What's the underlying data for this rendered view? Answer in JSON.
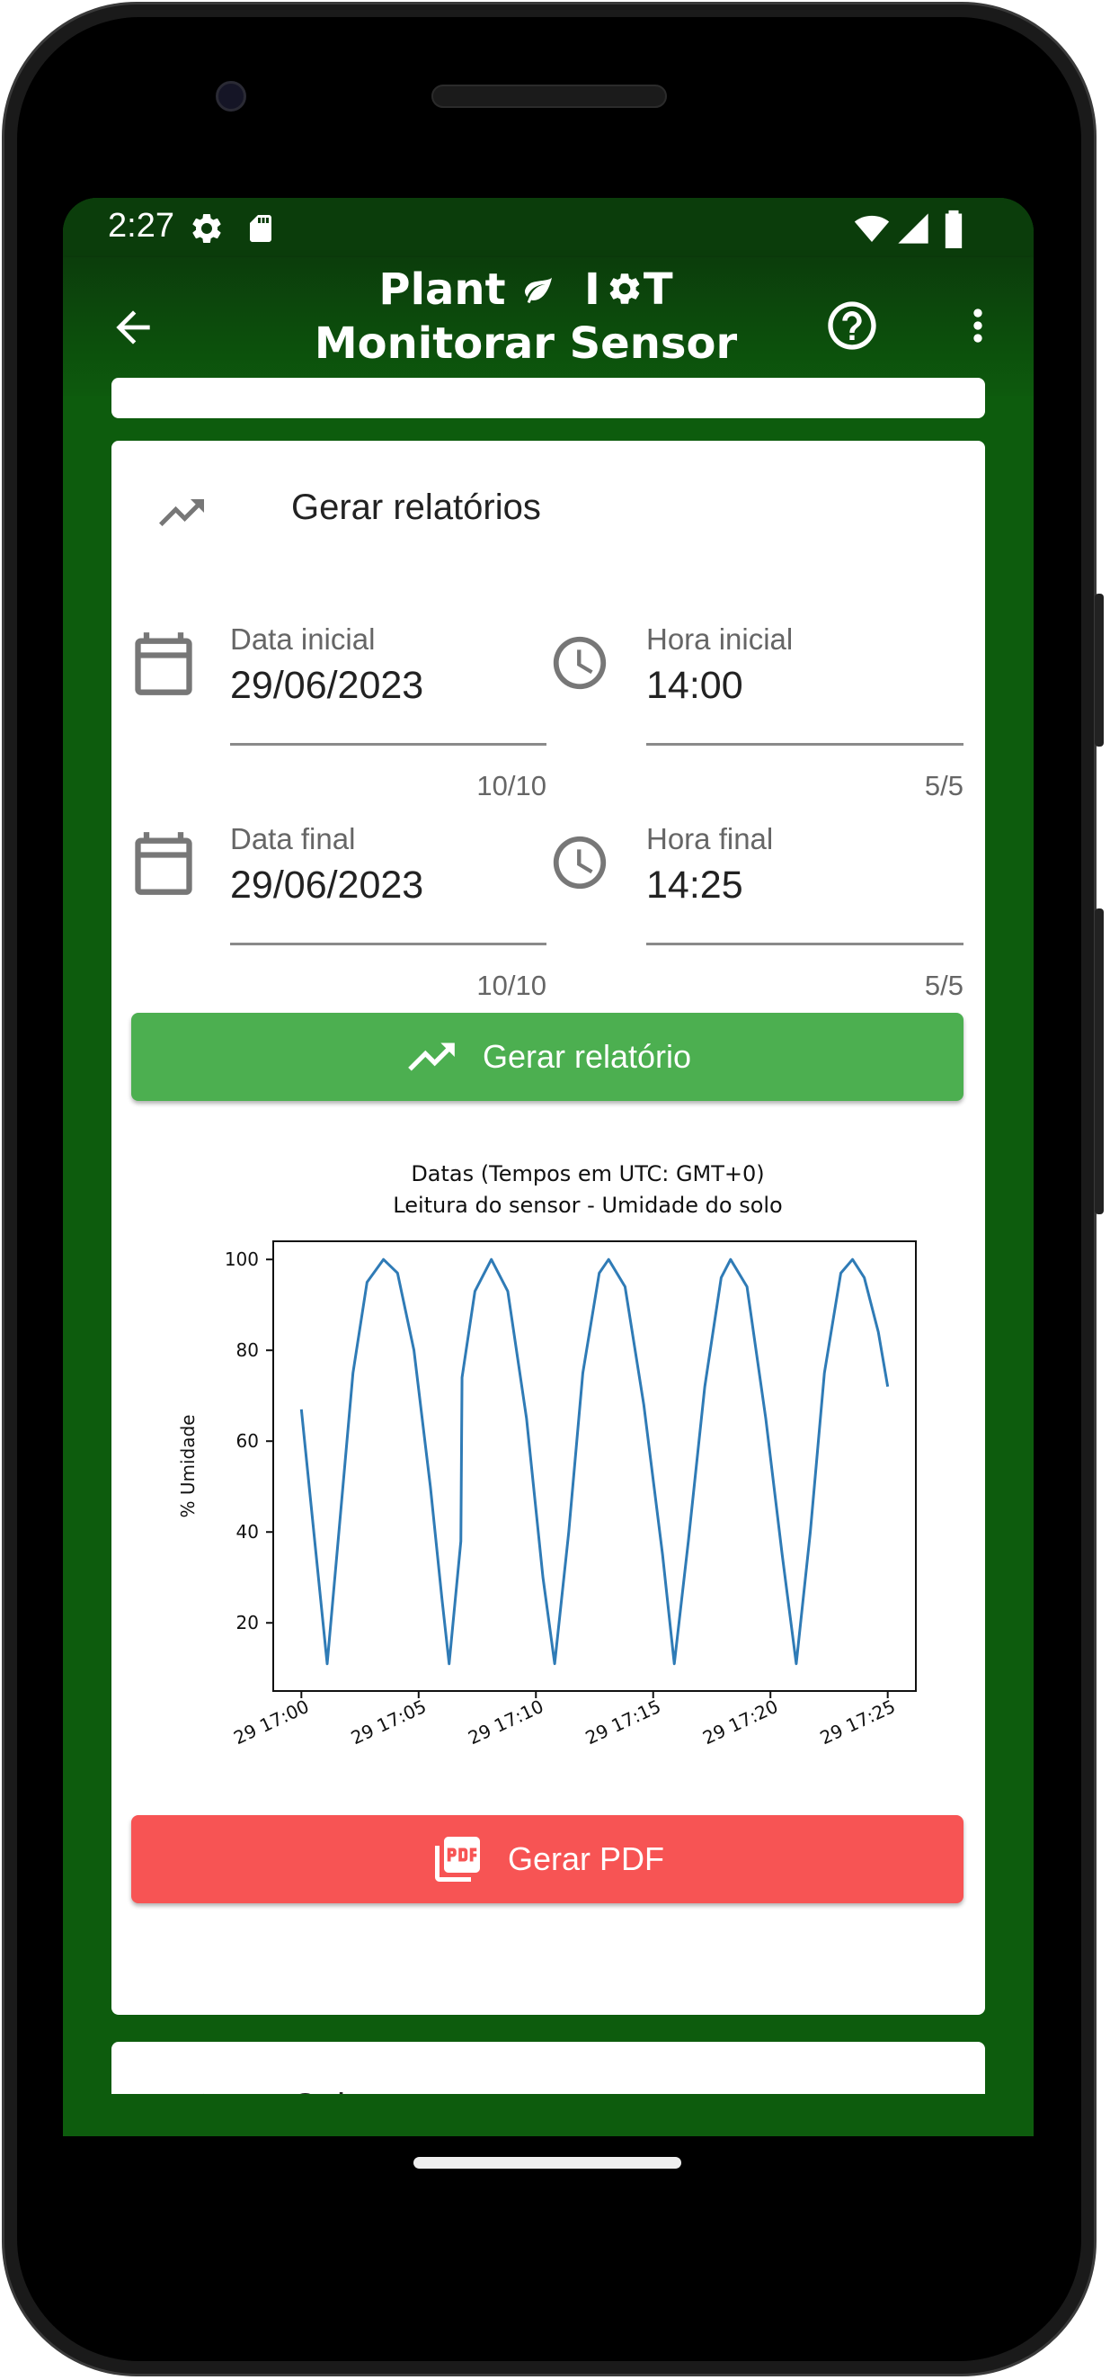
{
  "status_bar": {
    "time": "2:27"
  },
  "app_bar": {
    "title_line1": "Plant",
    "title_line1_b": "I",
    "title_line1_c": "T",
    "title_line2": "Monitorar Sensor"
  },
  "report_card": {
    "title": "Gerar relatórios",
    "start_date": {
      "label": "Data inicial",
      "value": "29/06/2023",
      "counter": "10/10"
    },
    "start_time": {
      "label": "Hora inicial",
      "value": "14:00",
      "counter": "5/5"
    },
    "end_date": {
      "label": "Data final",
      "value": "29/06/2023",
      "counter": "10/10"
    },
    "end_time": {
      "label": "Hora final",
      "value": "14:25",
      "counter": "5/5"
    },
    "generate_button": "Gerar relatório",
    "pdf_button": "Gerar PDF"
  },
  "next_card": {
    "title": "Cultura"
  },
  "colors": {
    "green_button": "#4caf50",
    "red_button": "#f75454",
    "app_green": "#0d5c0d",
    "line": "#2f7bb6"
  },
  "chart_data": {
    "type": "line",
    "title": "Datas (Tempos em UTC: GMT+0)",
    "subtitle": "Leitura do sensor - Umidade do solo",
    "ylabel": "% Umidade",
    "xlabel": "",
    "ylim": [
      5,
      104
    ],
    "yticks": [
      20,
      40,
      60,
      80,
      100
    ],
    "xtick_labels": [
      "29 17:00",
      "29 17:05",
      "29 17:10",
      "29 17:15",
      "29 17:20",
      "29 17:25"
    ],
    "xlim_minutes": [
      -1.2,
      26.2
    ],
    "series": [
      {
        "values": [
          [
            0,
            67
          ],
          [
            1.1,
            11
          ],
          [
            1.6,
            40
          ],
          [
            2.2,
            75
          ],
          [
            2.8,
            95
          ],
          [
            3.5,
            100
          ],
          [
            4.1,
            97
          ],
          [
            4.8,
            80
          ],
          [
            5.5,
            50
          ],
          [
            6.0,
            25
          ],
          [
            6.3,
            11
          ],
          [
            6.8,
            38
          ],
          [
            6.85,
            74
          ],
          [
            7.4,
            93
          ],
          [
            8.1,
            100
          ],
          [
            8.8,
            93
          ],
          [
            9.6,
            65
          ],
          [
            10.3,
            30
          ],
          [
            10.8,
            11
          ],
          [
            11.4,
            40
          ],
          [
            12.0,
            75
          ],
          [
            12.7,
            97
          ],
          [
            13.1,
            100
          ],
          [
            13.8,
            94
          ],
          [
            14.6,
            68
          ],
          [
            15.4,
            35
          ],
          [
            15.9,
            11
          ],
          [
            16.5,
            38
          ],
          [
            17.2,
            72
          ],
          [
            17.9,
            96
          ],
          [
            18.3,
            100
          ],
          [
            19.0,
            94
          ],
          [
            19.8,
            65
          ],
          [
            20.5,
            35
          ],
          [
            21.1,
            11
          ],
          [
            21.7,
            40
          ],
          [
            22.3,
            75
          ],
          [
            23.0,
            97
          ],
          [
            23.5,
            100
          ],
          [
            24.0,
            96
          ],
          [
            24.6,
            84
          ],
          [
            25.0,
            72
          ]
        ]
      }
    ]
  }
}
